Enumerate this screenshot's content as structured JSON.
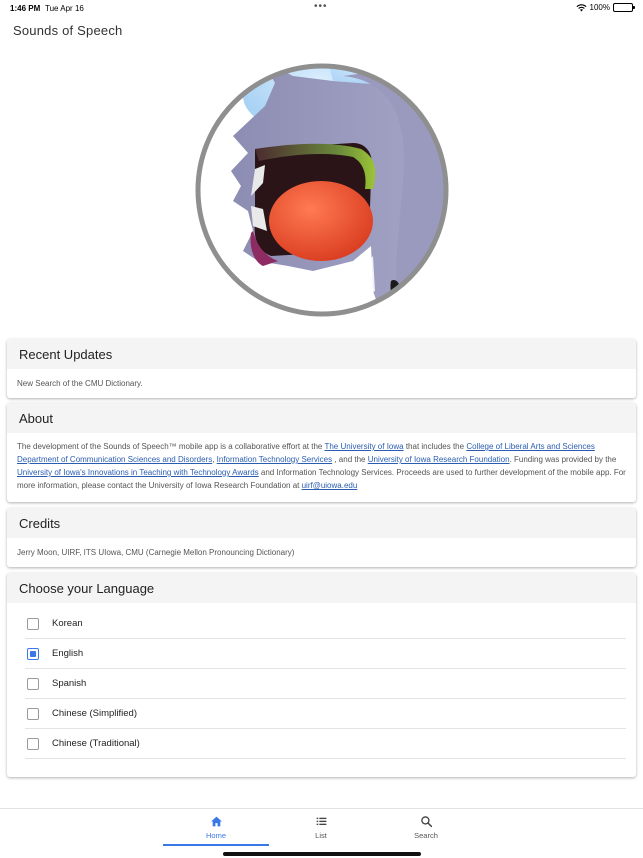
{
  "status_bar": {
    "time": "1:46 PM",
    "date": "Tue Apr 16",
    "battery": "100%",
    "dots": "•••"
  },
  "app": {
    "title": "Sounds of Speech"
  },
  "recent_updates": {
    "title": "Recent Updates",
    "text": "New Search of the CMU Dictionary."
  },
  "about": {
    "title": "About",
    "t1": "The development of the Sounds of Speech™ mobile app is a collaborative effort at the ",
    "link1": "The University of Iowa",
    "t2": " that includes the ",
    "link2": "College of Liberal Arts and Sciences Department of Communication Sciences and Disorders",
    "t3": ", ",
    "link3": "Information Technology Services",
    "t4": " , and the ",
    "link4": "University of Iowa Research Foundation",
    "t5": ". Funding was provided by the ",
    "link5": "University of Iowa's Innovations in Teaching with Technology Awards",
    "t6": " and Information Technology Services. Proceeds are used to further development of the mobile app. For more information, please contact the University of Iowa Research Foundation at ",
    "link6": "uirf@uiowa.edu"
  },
  "credits": {
    "title": "Credits",
    "text": "Jerry Moon, UIRF, ITS UIowa, CMU (Carnegie Mellon Pronouncing Dictionary)"
  },
  "language": {
    "title": "Choose your Language",
    "options": [
      {
        "label": "Korean",
        "checked": false
      },
      {
        "label": "English",
        "checked": true
      },
      {
        "label": "Spanish",
        "checked": false
      },
      {
        "label": "Chinese (Simplified)",
        "checked": false
      },
      {
        "label": "Chinese (Traditional)",
        "checked": false
      }
    ]
  },
  "tabs": [
    {
      "label": "Home",
      "icon": "home-icon",
      "active": true
    },
    {
      "label": "List",
      "icon": "list-icon",
      "active": false
    },
    {
      "label": "Search",
      "icon": "search-icon",
      "active": false
    }
  ],
  "colors": {
    "accent": "#3b78e7",
    "link": "#2a5db0",
    "header_bg": "#f4f4f4"
  }
}
